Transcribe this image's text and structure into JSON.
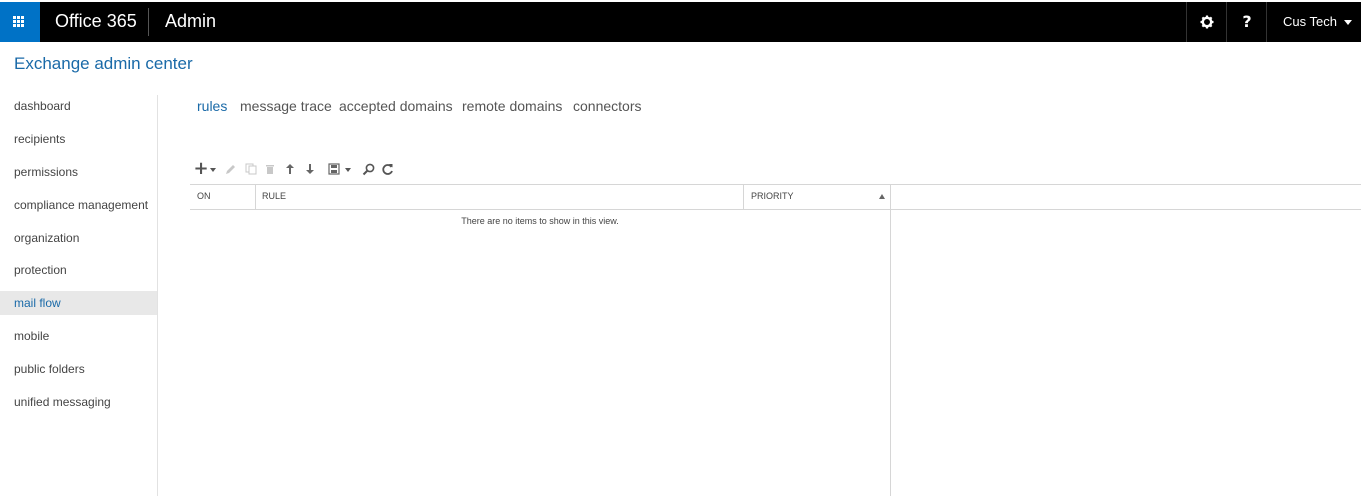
{
  "topbar": {
    "brand": "Office 365",
    "app_name": "Admin",
    "user_name": "Cus Tech",
    "accent_color": "#0072c6",
    "icons": [
      "waffle-icon",
      "gear-icon",
      "help-icon",
      "chevron-down-icon"
    ]
  },
  "page": {
    "title": "Exchange admin center"
  },
  "nav": {
    "items": [
      {
        "label": "dashboard"
      },
      {
        "label": "recipients"
      },
      {
        "label": "permissions"
      },
      {
        "label": "compliance management"
      },
      {
        "label": "organization"
      },
      {
        "label": "protection"
      },
      {
        "label": "mail flow",
        "selected": true
      },
      {
        "label": "mobile"
      },
      {
        "label": "public folders"
      },
      {
        "label": "unified messaging"
      }
    ]
  },
  "tabs": [
    {
      "label": "rules",
      "active": true
    },
    {
      "label": "message trace"
    },
    {
      "label": "accepted domains"
    },
    {
      "label": "remote domains"
    },
    {
      "label": "connectors"
    }
  ],
  "toolbar": {
    "icons": [
      "plus-icon",
      "edit-icon",
      "copy-icon",
      "delete-icon",
      "arrow-up-icon",
      "arrow-down-icon",
      "save-icon",
      "search-icon",
      "refresh-icon"
    ]
  },
  "grid": {
    "columns": [
      "ON",
      "RULE",
      "PRIORITY"
    ],
    "sort_column": "PRIORITY",
    "empty_message": "There are no items to show in this view."
  }
}
